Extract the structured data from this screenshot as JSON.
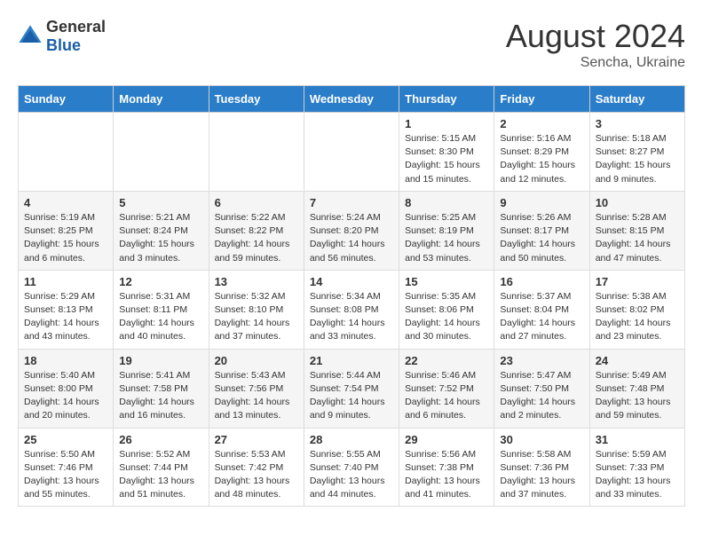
{
  "header": {
    "logo_general": "General",
    "logo_blue": "Blue",
    "month_year": "August 2024",
    "location": "Sencha, Ukraine"
  },
  "days_of_week": [
    "Sunday",
    "Monday",
    "Tuesday",
    "Wednesday",
    "Thursday",
    "Friday",
    "Saturday"
  ],
  "weeks": [
    [
      {
        "day": "",
        "info": ""
      },
      {
        "day": "",
        "info": ""
      },
      {
        "day": "",
        "info": ""
      },
      {
        "day": "",
        "info": ""
      },
      {
        "day": "1",
        "info": "Sunrise: 5:15 AM\nSunset: 8:30 PM\nDaylight: 15 hours\nand 15 minutes."
      },
      {
        "day": "2",
        "info": "Sunrise: 5:16 AM\nSunset: 8:29 PM\nDaylight: 15 hours\nand 12 minutes."
      },
      {
        "day": "3",
        "info": "Sunrise: 5:18 AM\nSunset: 8:27 PM\nDaylight: 15 hours\nand 9 minutes."
      }
    ],
    [
      {
        "day": "4",
        "info": "Sunrise: 5:19 AM\nSunset: 8:25 PM\nDaylight: 15 hours\nand 6 minutes."
      },
      {
        "day": "5",
        "info": "Sunrise: 5:21 AM\nSunset: 8:24 PM\nDaylight: 15 hours\nand 3 minutes."
      },
      {
        "day": "6",
        "info": "Sunrise: 5:22 AM\nSunset: 8:22 PM\nDaylight: 14 hours\nand 59 minutes."
      },
      {
        "day": "7",
        "info": "Sunrise: 5:24 AM\nSunset: 8:20 PM\nDaylight: 14 hours\nand 56 minutes."
      },
      {
        "day": "8",
        "info": "Sunrise: 5:25 AM\nSunset: 8:19 PM\nDaylight: 14 hours\nand 53 minutes."
      },
      {
        "day": "9",
        "info": "Sunrise: 5:26 AM\nSunset: 8:17 PM\nDaylight: 14 hours\nand 50 minutes."
      },
      {
        "day": "10",
        "info": "Sunrise: 5:28 AM\nSunset: 8:15 PM\nDaylight: 14 hours\nand 47 minutes."
      }
    ],
    [
      {
        "day": "11",
        "info": "Sunrise: 5:29 AM\nSunset: 8:13 PM\nDaylight: 14 hours\nand 43 minutes."
      },
      {
        "day": "12",
        "info": "Sunrise: 5:31 AM\nSunset: 8:11 PM\nDaylight: 14 hours\nand 40 minutes."
      },
      {
        "day": "13",
        "info": "Sunrise: 5:32 AM\nSunset: 8:10 PM\nDaylight: 14 hours\nand 37 minutes."
      },
      {
        "day": "14",
        "info": "Sunrise: 5:34 AM\nSunset: 8:08 PM\nDaylight: 14 hours\nand 33 minutes."
      },
      {
        "day": "15",
        "info": "Sunrise: 5:35 AM\nSunset: 8:06 PM\nDaylight: 14 hours\nand 30 minutes."
      },
      {
        "day": "16",
        "info": "Sunrise: 5:37 AM\nSunset: 8:04 PM\nDaylight: 14 hours\nand 27 minutes."
      },
      {
        "day": "17",
        "info": "Sunrise: 5:38 AM\nSunset: 8:02 PM\nDaylight: 14 hours\nand 23 minutes."
      }
    ],
    [
      {
        "day": "18",
        "info": "Sunrise: 5:40 AM\nSunset: 8:00 PM\nDaylight: 14 hours\nand 20 minutes."
      },
      {
        "day": "19",
        "info": "Sunrise: 5:41 AM\nSunset: 7:58 PM\nDaylight: 14 hours\nand 16 minutes."
      },
      {
        "day": "20",
        "info": "Sunrise: 5:43 AM\nSunset: 7:56 PM\nDaylight: 14 hours\nand 13 minutes."
      },
      {
        "day": "21",
        "info": "Sunrise: 5:44 AM\nSunset: 7:54 PM\nDaylight: 14 hours\nand 9 minutes."
      },
      {
        "day": "22",
        "info": "Sunrise: 5:46 AM\nSunset: 7:52 PM\nDaylight: 14 hours\nand 6 minutes."
      },
      {
        "day": "23",
        "info": "Sunrise: 5:47 AM\nSunset: 7:50 PM\nDaylight: 14 hours\nand 2 minutes."
      },
      {
        "day": "24",
        "info": "Sunrise: 5:49 AM\nSunset: 7:48 PM\nDaylight: 13 hours\nand 59 minutes."
      }
    ],
    [
      {
        "day": "25",
        "info": "Sunrise: 5:50 AM\nSunset: 7:46 PM\nDaylight: 13 hours\nand 55 minutes."
      },
      {
        "day": "26",
        "info": "Sunrise: 5:52 AM\nSunset: 7:44 PM\nDaylight: 13 hours\nand 51 minutes."
      },
      {
        "day": "27",
        "info": "Sunrise: 5:53 AM\nSunset: 7:42 PM\nDaylight: 13 hours\nand 48 minutes."
      },
      {
        "day": "28",
        "info": "Sunrise: 5:55 AM\nSunset: 7:40 PM\nDaylight: 13 hours\nand 44 minutes."
      },
      {
        "day": "29",
        "info": "Sunrise: 5:56 AM\nSunset: 7:38 PM\nDaylight: 13 hours\nand 41 minutes."
      },
      {
        "day": "30",
        "info": "Sunrise: 5:58 AM\nSunset: 7:36 PM\nDaylight: 13 hours\nand 37 minutes."
      },
      {
        "day": "31",
        "info": "Sunrise: 5:59 AM\nSunset: 7:33 PM\nDaylight: 13 hours\nand 33 minutes."
      }
    ]
  ]
}
